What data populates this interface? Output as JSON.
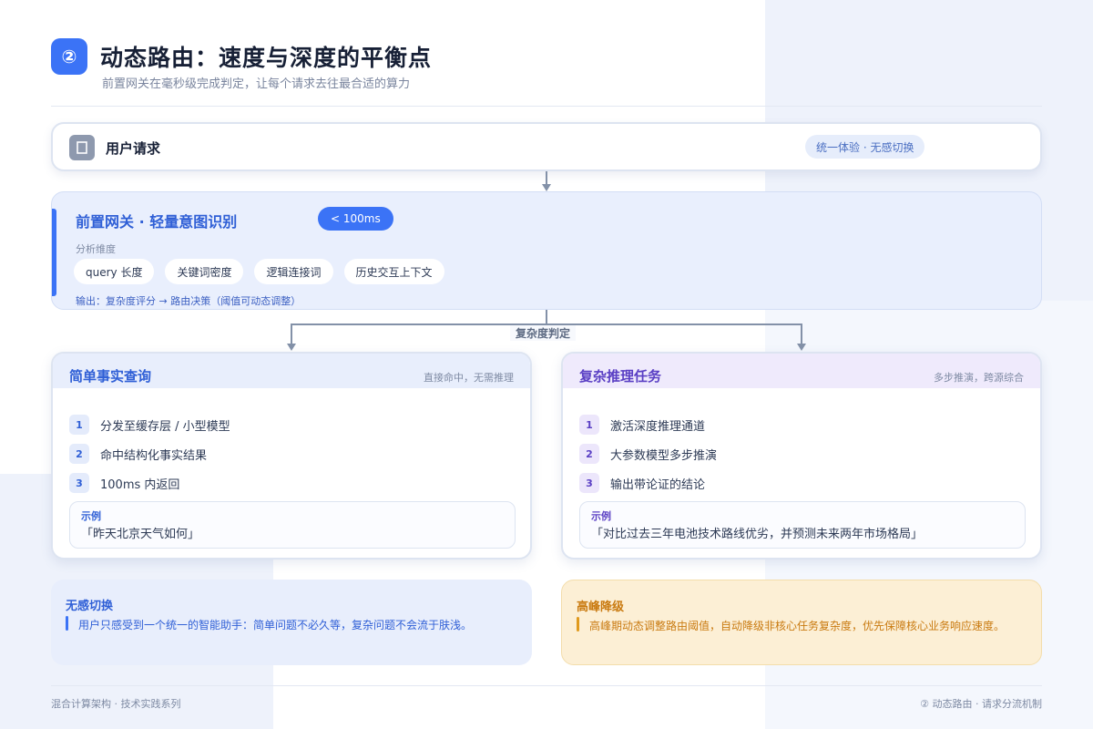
{
  "header": {
    "badge": "②",
    "title": "动态路由：速度与深度的平衡点",
    "subtitle": "前置网关在毫秒级完成判定，让每个请求去往最合适的算力"
  },
  "user_request": {
    "icon": "user-icon",
    "label": "用户请求",
    "tag": "统一体验 · 无感切换"
  },
  "gateway": {
    "title": "前置网关 · 轻量意图识别",
    "latency": "< 100ms",
    "dims_label": "分析维度",
    "dims": [
      "query 长度",
      "关键词密度",
      "逻辑连接词",
      "历史交互上下文"
    ],
    "output": "输出：复杂度评分 → 路由决策（阈值可动态调整）"
  },
  "judge_label": "复杂度判定",
  "routes": [
    {
      "title": "简单事实查询",
      "note": "直接命中，无需推理",
      "steps": [
        {
          "num": "1",
          "text": "分发至缓存层 / 小型模型"
        },
        {
          "num": "2",
          "text": "命中结构化事实结果"
        },
        {
          "num": "3",
          "text": "100ms 内返回"
        }
      ],
      "example_label": "示例",
      "example": "「昨天北京天气如何」"
    },
    {
      "title": "复杂推理任务",
      "note": "多步推演，跨源综合",
      "steps": [
        {
          "num": "1",
          "text": "激活深度推理通道"
        },
        {
          "num": "2",
          "text": "大参数模型多步推演"
        },
        {
          "num": "3",
          "text": "输出带论证的结论"
        }
      ],
      "example_label": "示例",
      "example": "「对比过去三年电池技术路线优劣，并预测未来两年市场格局」"
    }
  ],
  "notes": [
    {
      "title": "无感切换",
      "text": "用户只感受到一个统一的智能助手：简单问题不必久等，复杂问题不会流于肤浅。"
    },
    {
      "title": "高峰降级",
      "text": "高峰期动态调整路由阈值，自动降级非核心任务复杂度，优先保障核心业务响应速度。"
    }
  ],
  "footer": {
    "left": "混合计算架构 · 技术实践系列",
    "right": "② 动态路由 · 请求分流机制"
  },
  "colors": {
    "accent_blue": "#3b73f6",
    "accent_purple": "#5a3fc4",
    "accent_amber": "#c97a10"
  }
}
